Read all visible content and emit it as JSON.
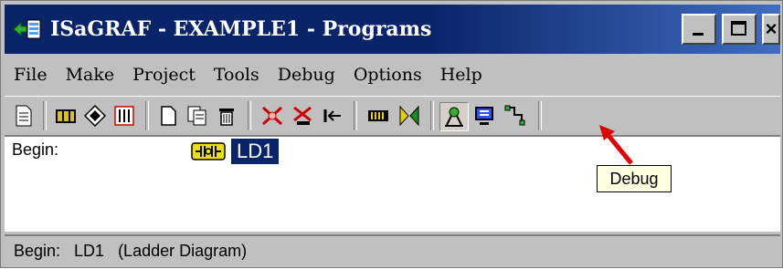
{
  "window": {
    "title": "ISaGRAF - EXAMPLE1 - Programs",
    "app_icon": "isagraf-app-icon",
    "controls": [
      "minimize-icon",
      "maximize-icon",
      "close-icon"
    ],
    "close_partial": "×"
  },
  "menu": {
    "items": [
      {
        "label": "File"
      },
      {
        "label": "Make"
      },
      {
        "label": "Project"
      },
      {
        "label": "Tools"
      },
      {
        "label": "Debug"
      },
      {
        "label": "Options"
      },
      {
        "label": "Help"
      }
    ]
  },
  "toolbar": {
    "buttons": [
      {
        "icon": "properties-icon"
      },
      {
        "icon": "dictionary-icon"
      },
      {
        "icon": "network-icon"
      },
      {
        "icon": "io-connection-icon"
      },
      {
        "icon": "new-program-icon"
      },
      {
        "icon": "copy-program-icon"
      },
      {
        "icon": "delete-program-icon"
      },
      {
        "icon": "verify-icon"
      },
      {
        "icon": "compile-icon"
      },
      {
        "icon": "touch-icon"
      },
      {
        "icon": "code-generator-icon"
      },
      {
        "icon": "download-icon"
      },
      {
        "icon": "debug-icon"
      },
      {
        "icon": "simulate-icon"
      },
      {
        "icon": "link-setup-icon"
      }
    ]
  },
  "content": {
    "section_label": "Begin:",
    "program": {
      "icon": "ladder-diagram-icon",
      "name": "LD1"
    }
  },
  "tooltip": {
    "text": "Debug"
  },
  "status": {
    "text": "Begin:   LD1   (Ladder Diagram)"
  },
  "colors": {
    "title_bar": "#0a246a",
    "selection": "#0a246a",
    "tooltip_bg": "#ffffe1",
    "annotation_arrow": "#e00000"
  }
}
